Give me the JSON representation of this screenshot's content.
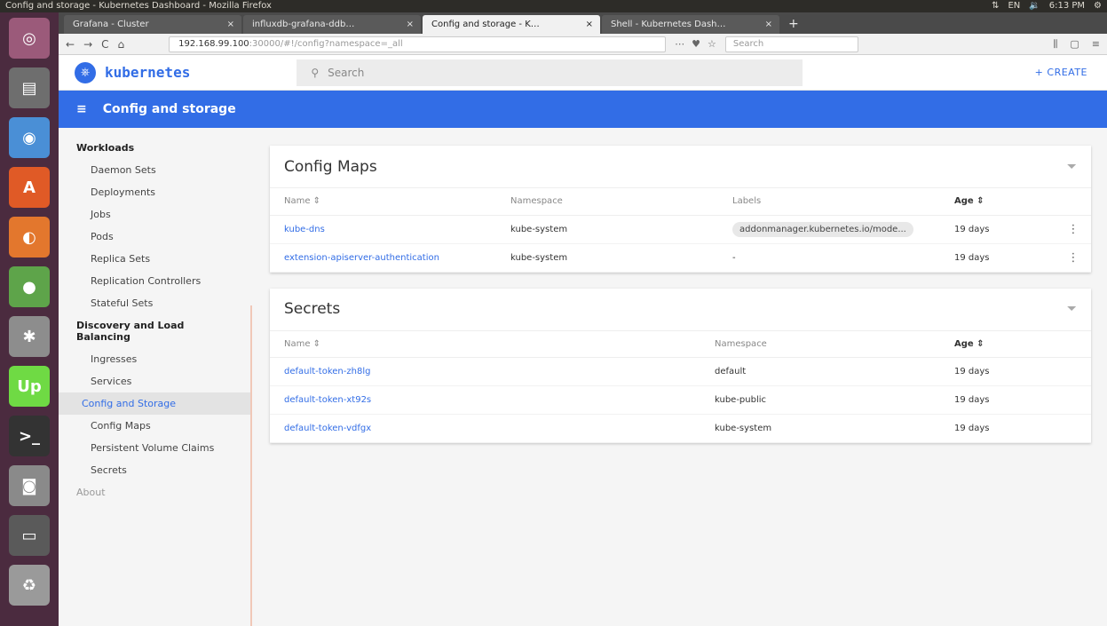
{
  "os": {
    "window_title": "Config and storage - Kubernetes Dashboard - Mozilla Firefox",
    "tray": [
      "⇅",
      "EN",
      "🔉",
      "6:13 PM",
      "⚙"
    ]
  },
  "launcher": {
    "items": [
      {
        "glyph": "◎",
        "color": "#9b5a7a"
      },
      {
        "glyph": "▤",
        "color": "#6e6e6e"
      },
      {
        "glyph": "◉",
        "color": "#4a8fd6"
      },
      {
        "glyph": "A",
        "color": "#e05a26"
      },
      {
        "glyph": "◐",
        "color": "#e3772d"
      },
      {
        "glyph": "●",
        "color": "#5ea44a"
      },
      {
        "glyph": "✱",
        "color": "#8d8d8d"
      },
      {
        "glyph": "Up",
        "color": "#6fda44"
      },
      {
        "glyph": ">_",
        "color": "#333333"
      },
      {
        "glyph": "◙",
        "color": "#8a8a8a"
      },
      {
        "glyph": "▭",
        "color": "#5a5a5a"
      },
      {
        "glyph": "♻",
        "color": "#9a9a9a"
      }
    ]
  },
  "tabs": [
    {
      "label": "Grafana - Cluster",
      "close": "×",
      "active": false
    },
    {
      "label": "influxdb-grafana-ddb…",
      "close": "×",
      "active": false
    },
    {
      "label": "Config and storage - K…",
      "close": "×",
      "active": true
    },
    {
      "label": "Shell - Kubernetes Dash…",
      "close": "×",
      "active": false
    }
  ],
  "newtab": "+",
  "nav": {
    "back": "←",
    "forward": "→",
    "reload": "C",
    "home": "⌂",
    "url_host": "192.168.99.100",
    "url_rest": ":30000/#!/config?namespace=_all",
    "page_actions": [
      "⋯",
      "♥",
      "☆"
    ],
    "search_placeholder": "Search",
    "right_icons": [
      "⫼",
      "▢",
      "≡"
    ]
  },
  "k8s": {
    "brand": "kubernetes",
    "logo_glyph": "⎈",
    "search_icon": "⚲",
    "search_placeholder": "Search",
    "create_label": "+ CREATE",
    "menu_icon": "≡",
    "section_title": "Config and storage"
  },
  "sidebar": {
    "workloads": "Workloads",
    "workload_items": [
      "Daemon Sets",
      "Deployments",
      "Jobs",
      "Pods",
      "Replica Sets",
      "Replication Controllers",
      "Stateful Sets"
    ],
    "discovery": "Discovery and Load Balancing",
    "discovery_items": [
      "Ingresses",
      "Services"
    ],
    "config_storage": "Config and Storage",
    "config_items": [
      "Config Maps",
      "Persistent Volume Claims",
      "Secrets"
    ],
    "about": "About"
  },
  "config_maps": {
    "title": "Config Maps",
    "filter_icon": "⏷",
    "columns": [
      "Name ⇕",
      "Namespace",
      "Labels",
      "Age ⇕"
    ],
    "rows": [
      {
        "name": "kube-dns",
        "namespace": "kube-system",
        "labels": "addonmanager.kubernetes.io/mode...",
        "age": "19 days",
        "menu": "⋮"
      },
      {
        "name": "extension-apiserver-authentication",
        "namespace": "kube-system",
        "labels": "-",
        "age": "19 days",
        "menu": "⋮"
      }
    ]
  },
  "secrets": {
    "title": "Secrets",
    "filter_icon": "⏷",
    "columns": [
      "Name ⇕",
      "Namespace",
      "Age ⇕"
    ],
    "rows": [
      {
        "name": "default-token-zh8lg",
        "namespace": "default",
        "age": "19 days"
      },
      {
        "name": "default-token-xt92s",
        "namespace": "kube-public",
        "age": "19 days"
      },
      {
        "name": "default-token-vdfgx",
        "namespace": "kube-system",
        "age": "19 days"
      }
    ]
  }
}
